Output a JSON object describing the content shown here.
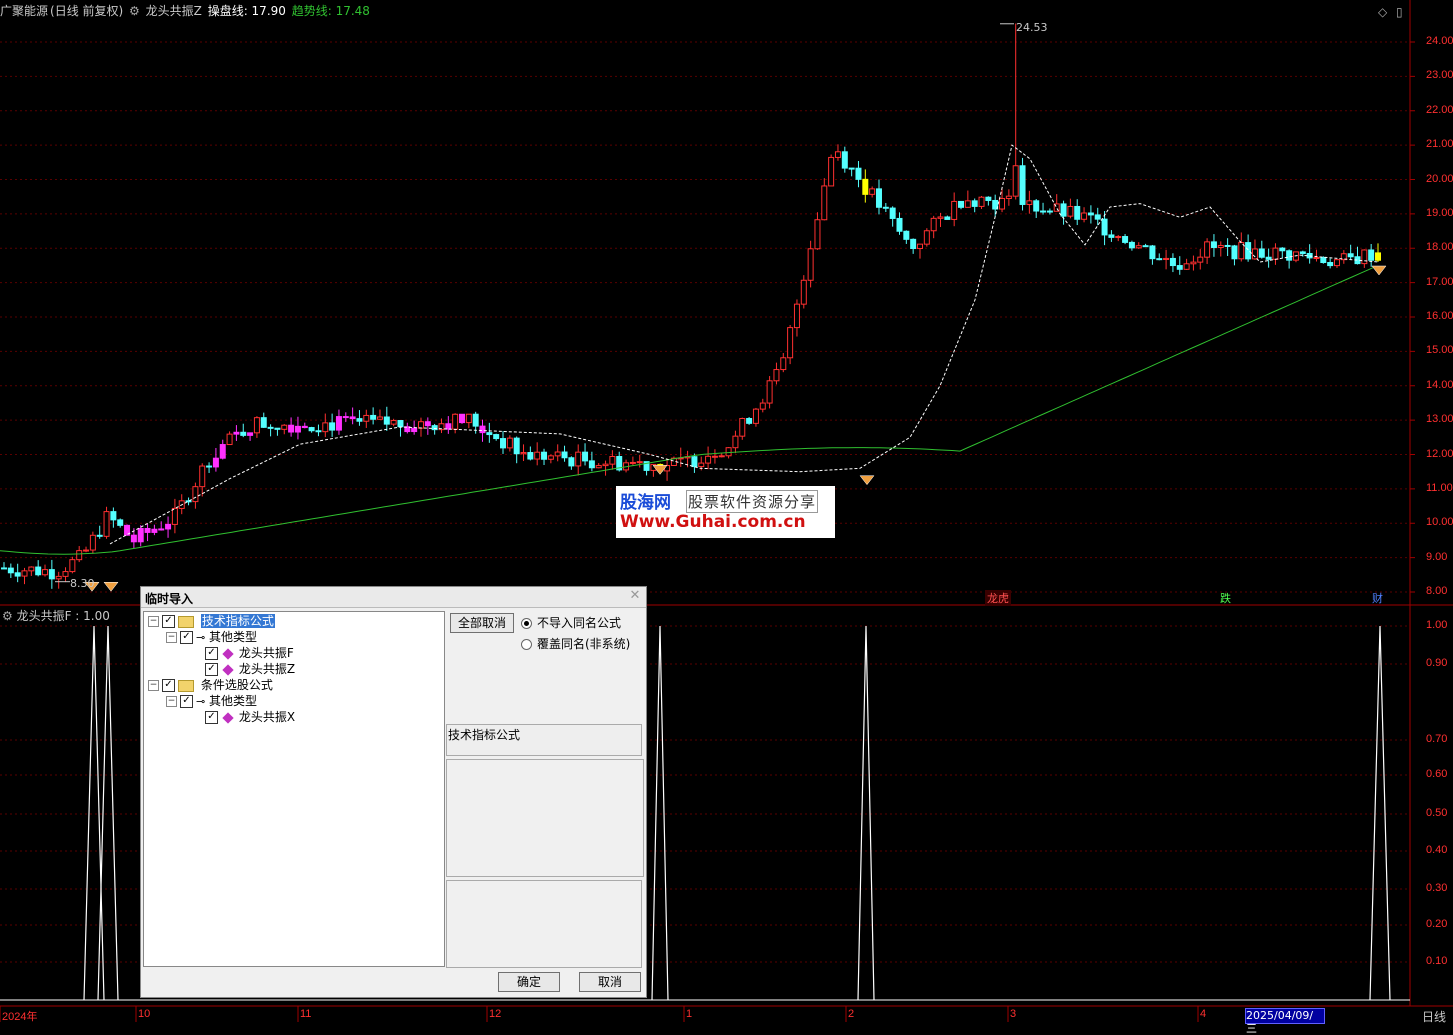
{
  "header": {
    "stock_name": "广聚能源",
    "period_mode": "(日线 前复权)",
    "indicator_name": "龙头共振Z",
    "line1_label": "操盘线: 17.90",
    "line2_label": "趋势线: 17.48"
  },
  "price_axis": [
    "24.00",
    "23.00",
    "22.00",
    "21.00",
    "20.00",
    "19.00",
    "18.00",
    "17.00",
    "16.00",
    "15.00",
    "14.00",
    "13.00",
    "12.00",
    "11.00",
    "10.00",
    "9.00",
    "8.00"
  ],
  "price_high_label": "24.53",
  "price_low_label": "8.30",
  "event_markers": {
    "m1": "龙虎",
    "m2": "跌",
    "m3": "财"
  },
  "sub_chart": {
    "label": "龙头共振F : 1.00",
    "axis": [
      "1.00",
      "0.90",
      "0.70",
      "0.60",
      "0.50",
      "0.40",
      "0.30",
      "0.20",
      "0.10"
    ]
  },
  "date_axis": {
    "labels": [
      "2024年",
      "10",
      "11",
      "12",
      "1",
      "2",
      "3",
      "4"
    ],
    "cursor_date": "2025/04/09/三",
    "period_button": "日线"
  },
  "watermark": {
    "line1": "股海网",
    "line1b": "股票软件资源分享",
    "line2": "Www.Guhai.com.cn"
  },
  "dialog": {
    "title": "临时导入",
    "tree": {
      "n1": "技术指标公式",
      "n2": "其他类型",
      "n3": "龙头共振F",
      "n4": "龙头共振Z",
      "n5": "条件选股公式",
      "n6": "其他类型",
      "n7": "龙头共振X"
    },
    "deselect_all": "全部取消",
    "radio1": "不导入同名公式",
    "radio2": "覆盖同名(非系统)",
    "info_text": "技术指标公式",
    "ok": "确定",
    "cancel": "取消"
  },
  "colors": {
    "up": "#ff3030",
    "down": "#54ffff",
    "signal": "#ff30ff",
    "ma": "#30c030",
    "trend": "#ffffff",
    "yellow": "#ffff00"
  },
  "chart_data": {
    "type": "candlestick",
    "price_range": [
      7.8,
      24.7
    ],
    "candles_approx": [
      [
        8.8,
        8.7,
        8.9,
        8.6
      ],
      [
        8.7,
        8.6,
        8.8,
        8.5
      ],
      [
        8.6,
        8.7,
        8.8,
        8.5
      ],
      [
        8.7,
        8.6,
        8.8,
        8.5
      ],
      [
        8.6,
        8.7,
        8.9,
        8.5
      ],
      [
        8.7,
        8.5,
        8.8,
        8.4
      ],
      [
        8.5,
        8.4,
        8.6,
        8.3
      ],
      [
        8.4,
        8.6,
        8.7,
        8.3
      ],
      [
        8.6,
        8.8,
        8.9,
        8.5
      ],
      [
        8.8,
        9.0,
        9.1,
        8.7
      ],
      [
        9.0,
        9.3,
        9.4,
        8.9
      ],
      [
        9.3,
        9.6,
        9.8,
        9.2
      ],
      [
        9.6,
        10.4,
        10.6,
        9.5
      ],
      [
        10.4,
        10.1,
        10.6,
        9.9
      ],
      [
        10.1,
        9.4,
        10.2,
        9.3
      ],
      [
        9.4,
        9.6,
        9.8,
        9.3
      ],
      [
        9.6,
        9.5,
        9.7,
        9.3
      ],
      [
        9.5,
        9.6,
        9.8,
        9.4
      ],
      [
        9.6,
        9.7,
        9.9,
        9.5
      ],
      [
        9.7,
        9.9,
        10.0,
        9.6
      ],
      [
        9.9,
        10.4,
        10.5,
        9.8
      ],
      [
        10.4,
        11.4,
        11.5,
        10.2
      ],
      [
        11.4,
        11.8,
        12.0,
        11.2
      ],
      [
        11.8,
        11.4,
        12.0,
        11.2
      ],
      [
        11.4,
        11.8,
        12.0,
        11.3
      ],
      [
        11.8,
        12.1,
        12.3,
        11.6
      ],
      [
        12.1,
        12.4,
        12.5,
        11.9
      ],
      [
        12.4,
        12.2,
        12.6,
        12.0
      ],
      [
        12.2,
        12.5,
        12.7,
        12.0
      ],
      [
        12.5,
        12.8,
        13.0,
        12.3
      ],
      [
        12.8,
        12.7,
        13.2,
        12.5
      ],
      [
        12.7,
        13.0,
        13.2,
        12.5
      ],
      [
        13.0,
        12.8,
        13.2,
        12.6
      ],
      [
        12.8,
        12.9,
        13.1,
        12.6
      ],
      [
        12.9,
        12.8,
        13.0,
        12.6
      ],
      [
        12.8,
        12.5,
        12.9,
        12.3
      ],
      [
        12.5,
        12.9,
        13.0,
        12.3
      ],
      [
        12.9,
        12.8,
        13.1,
        12.6
      ],
      [
        12.8,
        12.4,
        12.9,
        12.2
      ],
      [
        12.4,
        12.7,
        12.9,
        12.3
      ]
    ],
    "ma_series": "slow moving average rising from ~9.2 to ~17.5",
    "trend_series": "dashed line tracking price"
  }
}
